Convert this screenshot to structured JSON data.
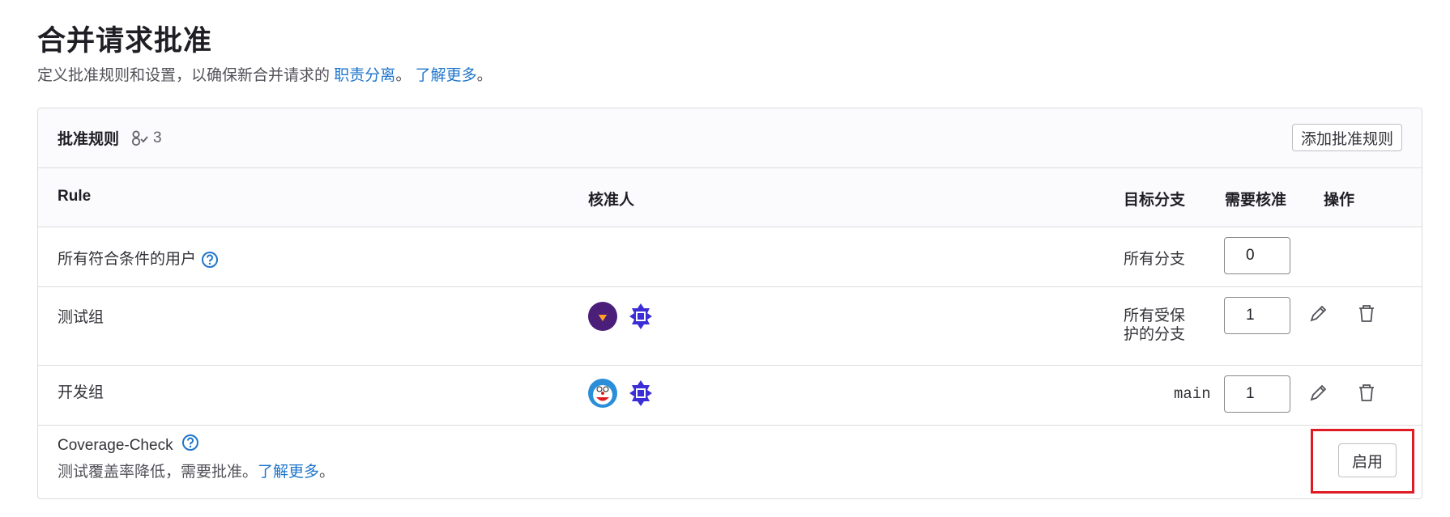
{
  "page": {
    "title": "合并请求批准",
    "description_prefix": "定义批准规则和设置，以确保新合并请求的",
    "link_duties": "职责分离",
    "sep": "。",
    "link_learn_more": "了解更多",
    "suffix": "。"
  },
  "card": {
    "title": "批准规则",
    "count": "3",
    "count_icon": "approval-check-icon",
    "add_rule_button": "添加批准规则"
  },
  "table": {
    "headers": {
      "rule": "Rule",
      "approvers": "核准人",
      "target_branch": "目标分支",
      "approvals_required": "需要核准",
      "actions": "操作"
    },
    "rows": [
      {
        "name": "所有符合条件的用户",
        "target": "所有分支",
        "required": "0"
      },
      {
        "name": "测试组",
        "target_line1": "所有受保",
        "target_line2": "护的分支",
        "required": "1"
      },
      {
        "name": "开发组",
        "target": "main",
        "required": "1"
      }
    ]
  },
  "coverage": {
    "name": "Coverage-Check",
    "desc": "测试覆盖率降低，需要批准。",
    "link": "了解更多",
    "suffix": "。",
    "enable_button": "启用"
  },
  "colors": {
    "link": "#1f75cb",
    "highlight": "#e01b24"
  }
}
